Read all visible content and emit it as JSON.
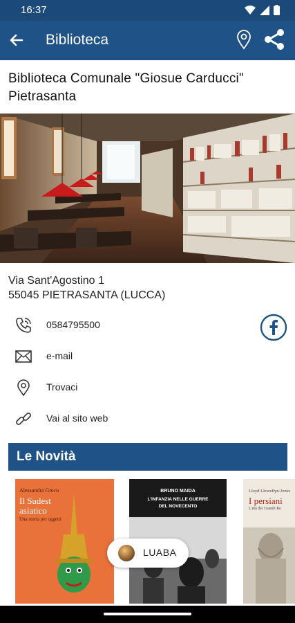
{
  "status_bar": {
    "time": "16:37"
  },
  "app_bar": {
    "title": "Biblioteca",
    "back_icon": "arrow-left-icon",
    "map_icon": "map-pin-icon",
    "share_icon": "share-icon"
  },
  "library": {
    "name": "Biblioteca Comunale \"Giosue Carducci\" Pietrasanta"
  },
  "address": {
    "line1": "Via Sant'Agostino 1",
    "line2": "55045 PIETRASANTA (LUCCA)"
  },
  "contacts": {
    "phone": "0584795500",
    "email": "e-mail",
    "find": "Trovaci",
    "website": "Vai al sito web"
  },
  "section": {
    "title": "Le Novità"
  },
  "books": [
    {
      "author": "Alessandra Greco",
      "title_line1": "Il Sudest",
      "title_line2": "asiatico",
      "subtitle": "Una storia per oggetti"
    },
    {
      "author": "BRUNO MAIDA",
      "title_line1": "L'INFANZIA NELLE GUERRE",
      "title_line2": "DEL NOVECENTO"
    },
    {
      "author": "Lloyd Llewellyn-Jones",
      "title_line1": "I persiani",
      "subtitle": "L'età dei Grandi Re"
    }
  ],
  "chip": {
    "label": "LUABA"
  },
  "colors": {
    "primary": "#1f5286",
    "status": "#1b4a7a",
    "book1_bg": "#e9713a"
  }
}
